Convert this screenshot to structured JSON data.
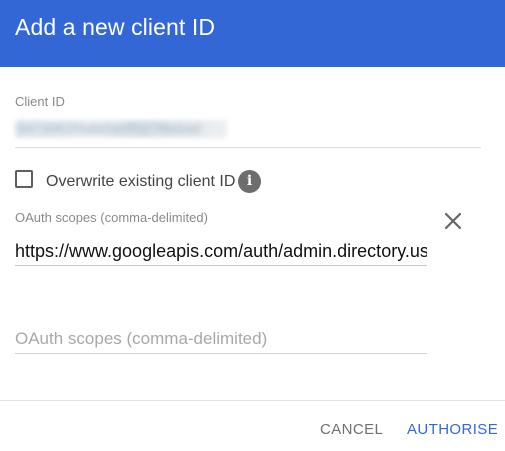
{
  "dialog": {
    "title": "Add a new client ID"
  },
  "client_id": {
    "label": "Client ID",
    "value_obscured": "6473982f0afe0a0ff527f8ebad"
  },
  "overwrite": {
    "label": "Overwrite existing client ID",
    "checked": false,
    "info_icon": "info-icon"
  },
  "scopes": {
    "label": "OAuth scopes (comma-delimited)",
    "value": "https://www.googleapis.com/auth/admin.directory.user",
    "remove_icon": "close-icon",
    "empty_placeholder": "OAuth scopes (comma-delimited)"
  },
  "actions": {
    "cancel": "CANCEL",
    "authorise": "AUTHORISE"
  },
  "colors": {
    "header": "#3367d6",
    "primary_action": "#3367d6"
  }
}
